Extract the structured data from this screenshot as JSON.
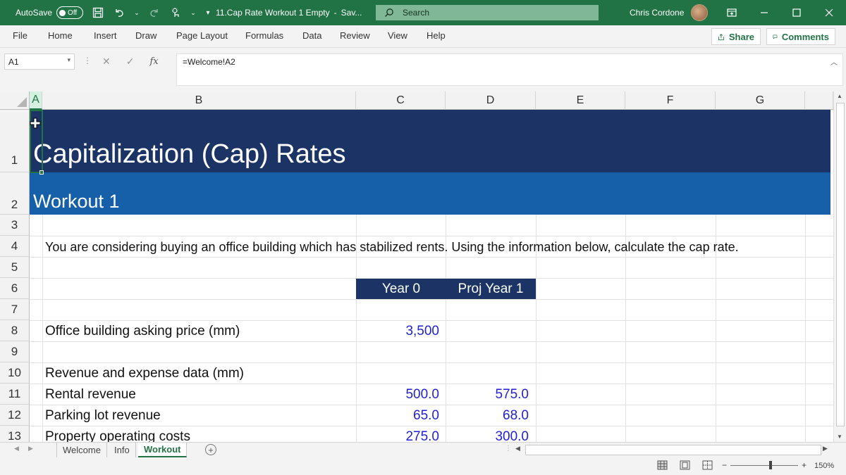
{
  "titlebar": {
    "autosave_label": "AutoSave",
    "autosave_state": "Off",
    "document_title": "11.Cap Rate Workout 1 Empty",
    "separator": "-",
    "save_status": "Sav...",
    "search_placeholder": "Search",
    "user_name": "Chris Cordone",
    "bg_color": "#217346"
  },
  "ribbon": {
    "tabs": [
      "File",
      "Home",
      "Insert",
      "Draw",
      "Page Layout",
      "Formulas",
      "Data",
      "Review",
      "View",
      "Help"
    ],
    "share_label": "Share",
    "comments_label": "Comments"
  },
  "formula_bar": {
    "name_box": "A1",
    "formula": "=Welcome!A2",
    "fx_label": "fx"
  },
  "columns": [
    "A",
    "B",
    "C",
    "D",
    "E",
    "F",
    "G"
  ],
  "selected_column": "A",
  "rows": [
    "1",
    "2",
    "3",
    "4",
    "5",
    "6",
    "7",
    "8",
    "9",
    "10",
    "11",
    "12",
    "13"
  ],
  "sheet": {
    "title": "Capitalization (Cap) Rates",
    "subtitle": "Workout 1",
    "instructions": "You are considering buying an office building which has stabilized rents.  Using the information below, calculate the cap rate.",
    "col_headers": [
      "Year 0",
      "Proj Year 1"
    ],
    "asking_price_label": "Office building asking price (mm)",
    "asking_price_value": "3,500",
    "rev_exp_label": "Revenue and expense data (mm)",
    "line_items": [
      {
        "label": "Rental revenue",
        "year0": "500.0",
        "year1": "575.0"
      },
      {
        "label": "Parking lot revenue",
        "year0": "65.0",
        "year1": "68.0"
      },
      {
        "label": "Property operating costs",
        "year0": "275.0",
        "year1": "300.0"
      }
    ],
    "title_band_color": "#1b3465",
    "subtitle_band_color": "#1560a8",
    "input_number_color": "#1f1fd6"
  },
  "sheet_tabs": [
    {
      "name": "Welcome",
      "active": false
    },
    {
      "name": "Info",
      "active": false
    },
    {
      "name": "Workout",
      "active": true
    }
  ],
  "statusbar": {
    "zoom": "150%"
  }
}
